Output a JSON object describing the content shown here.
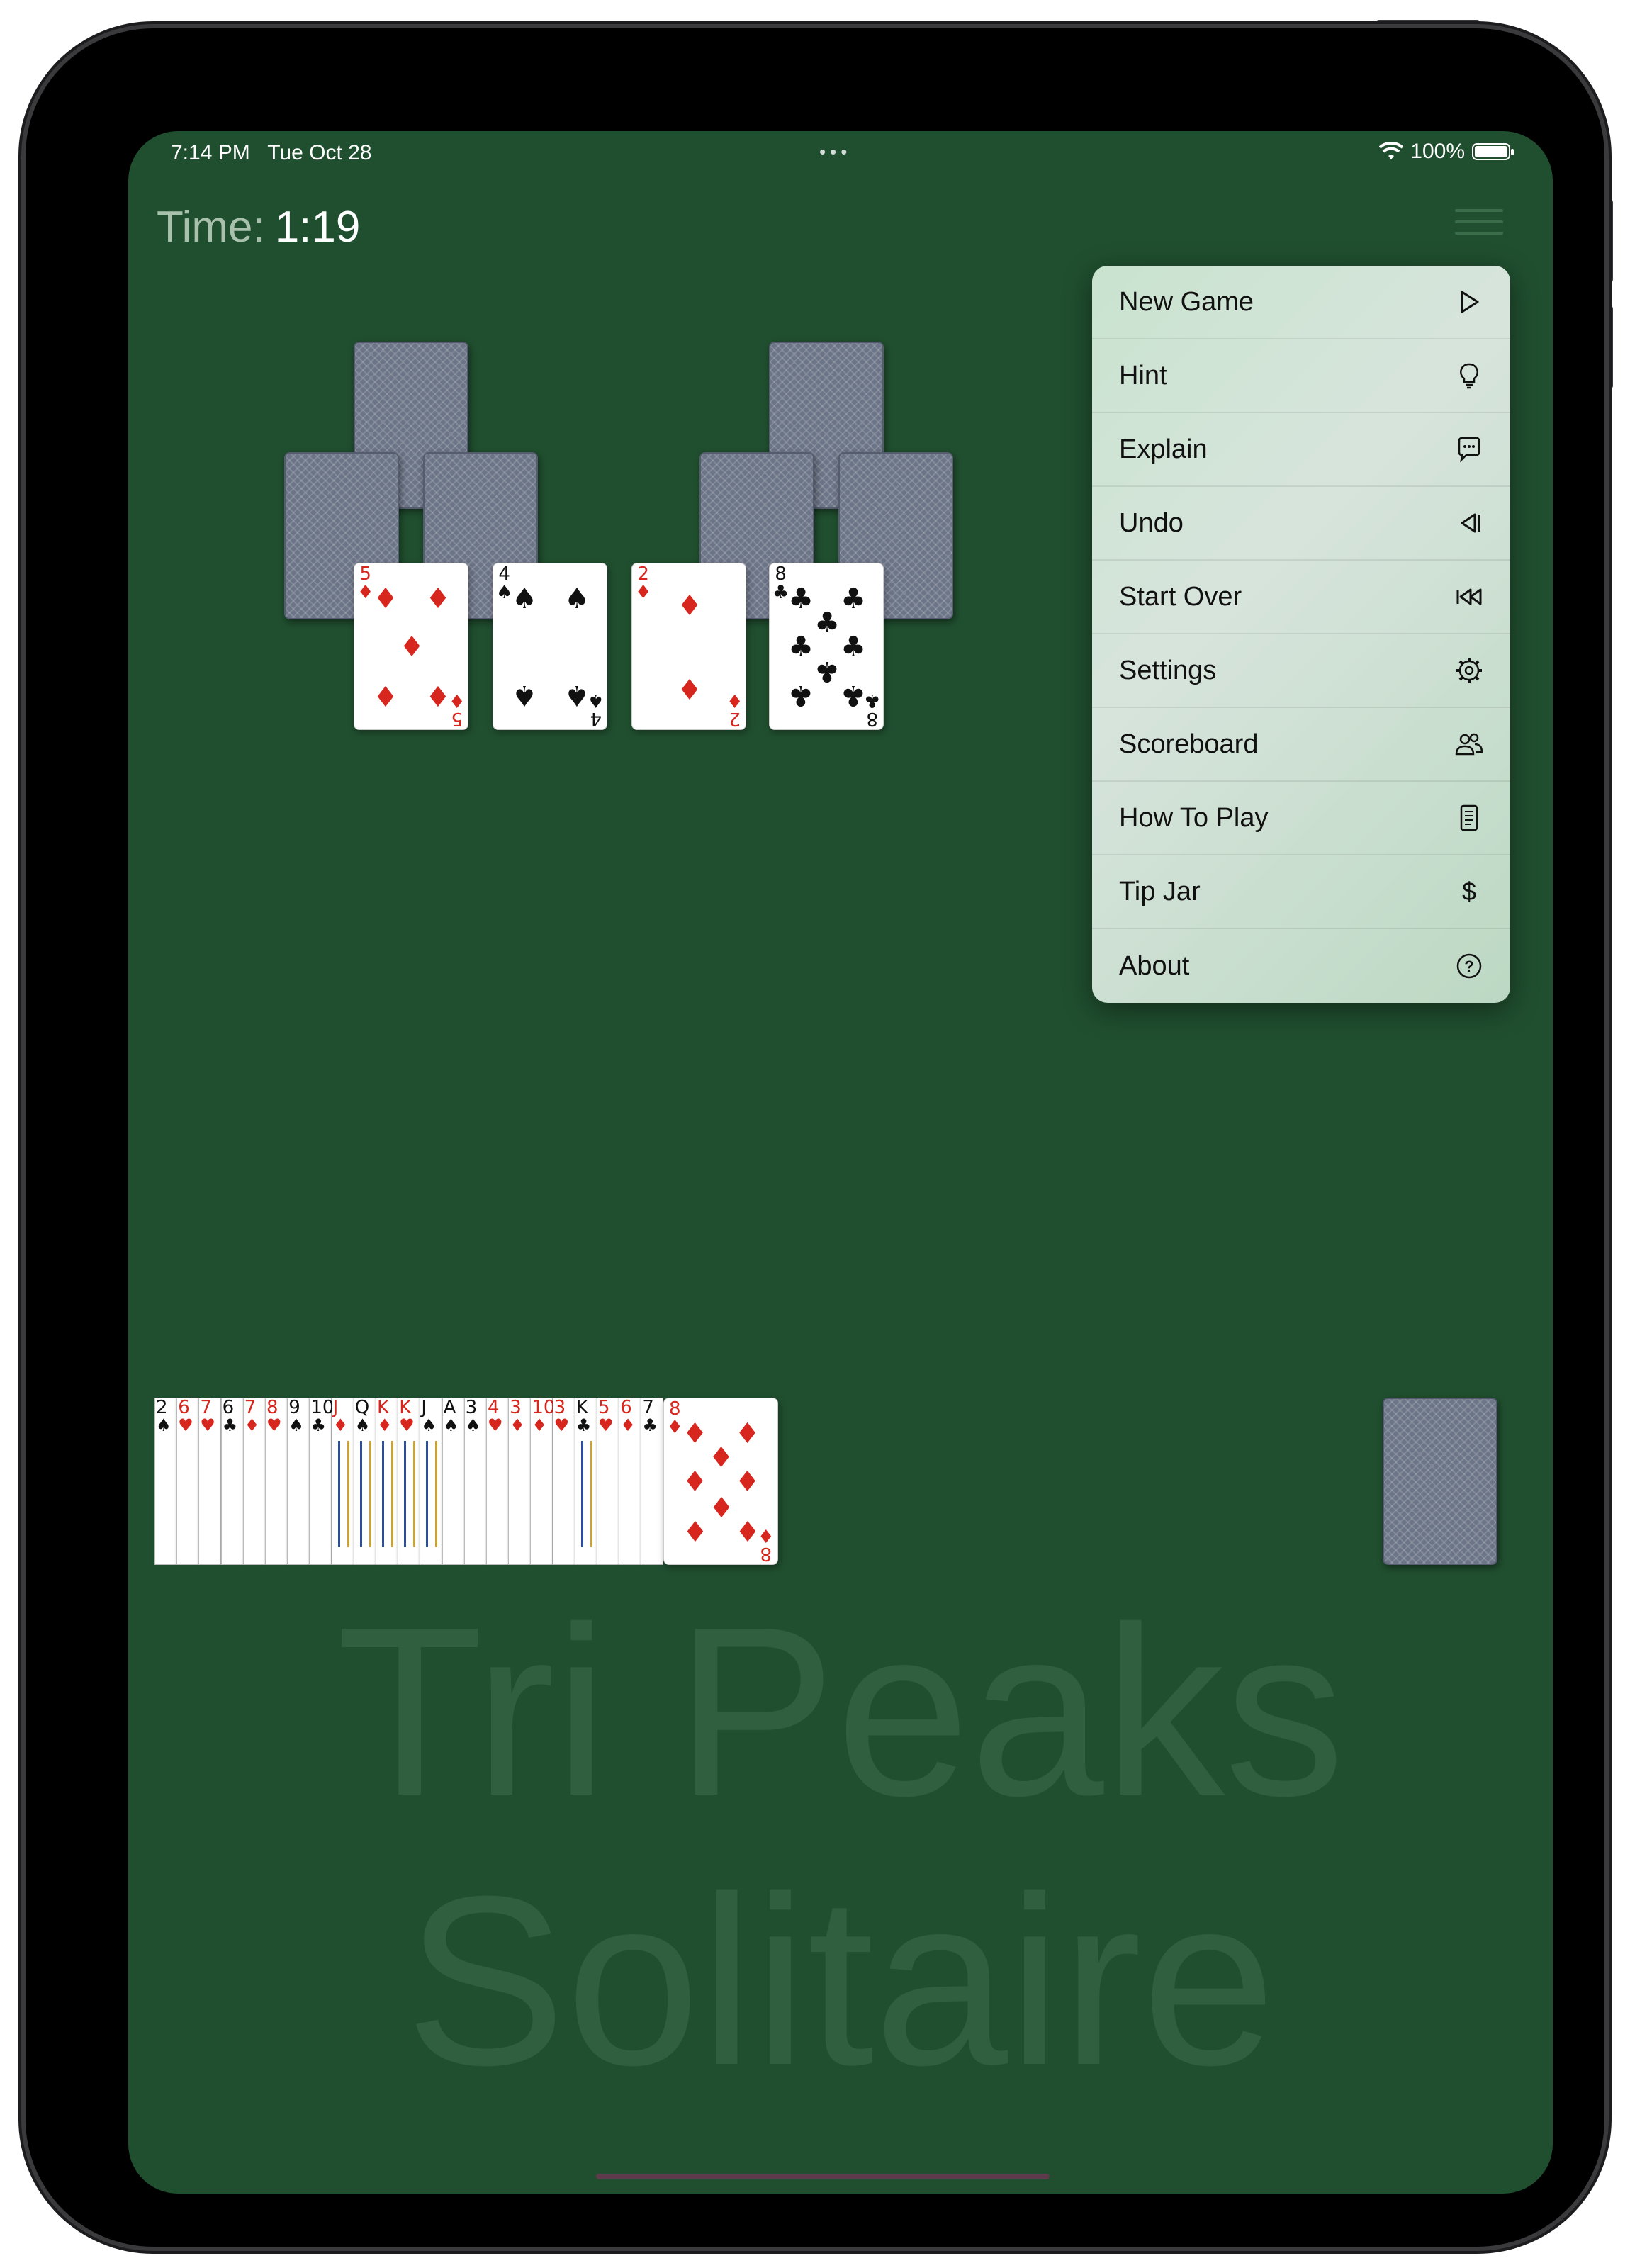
{
  "status_bar": {
    "time": "7:14 PM",
    "date": "Tue Oct 28",
    "dots": "•••",
    "battery": "100%"
  },
  "timer": {
    "label": "Time:",
    "value": "1:19"
  },
  "watermark": {
    "line1": "Tri Peaks",
    "line2": "Solitaire"
  },
  "peaks": [
    {
      "rank": "5",
      "suit": "♦",
      "color": "red"
    },
    {
      "rank": "4",
      "suit": "♠",
      "color": "black"
    },
    {
      "rank": "2",
      "suit": "♦",
      "color": "red"
    },
    {
      "rank": "8",
      "suit": "♣",
      "color": "black"
    }
  ],
  "waste_pile": [
    {
      "rank": "2",
      "suit": "♠",
      "color": "black"
    },
    {
      "rank": "6",
      "suit": "♥",
      "color": "red"
    },
    {
      "rank": "7",
      "suit": "♥",
      "color": "red"
    },
    {
      "rank": "6",
      "suit": "♣",
      "color": "black"
    },
    {
      "rank": "7",
      "suit": "♦",
      "color": "red"
    },
    {
      "rank": "8",
      "suit": "♥",
      "color": "red"
    },
    {
      "rank": "9",
      "suit": "♠",
      "color": "black"
    },
    {
      "rank": "10",
      "suit": "♣",
      "color": "black"
    },
    {
      "rank": "J",
      "suit": "♦",
      "color": "red"
    },
    {
      "rank": "Q",
      "suit": "♠",
      "color": "black"
    },
    {
      "rank": "K",
      "suit": "♦",
      "color": "red"
    },
    {
      "rank": "K",
      "suit": "♥",
      "color": "red"
    },
    {
      "rank": "J",
      "suit": "♠",
      "color": "black"
    },
    {
      "rank": "A",
      "suit": "♠",
      "color": "black"
    },
    {
      "rank": "3",
      "suit": "♠",
      "color": "black"
    },
    {
      "rank": "4",
      "suit": "♥",
      "color": "red"
    },
    {
      "rank": "3",
      "suit": "♦",
      "color": "red"
    },
    {
      "rank": "10",
      "suit": "♦",
      "color": "red"
    },
    {
      "rank": "3",
      "suit": "♥",
      "color": "red"
    },
    {
      "rank": "K",
      "suit": "♣",
      "color": "black"
    },
    {
      "rank": "5",
      "suit": "♥",
      "color": "red"
    },
    {
      "rank": "6",
      "suit": "♦",
      "color": "red"
    },
    {
      "rank": "7",
      "suit": "♣",
      "color": "black"
    }
  ],
  "waste_top": {
    "rank": "8",
    "suit": "♦",
    "color": "red"
  },
  "menu": [
    {
      "label": "New Game",
      "icon": "play-icon"
    },
    {
      "label": "Hint",
      "icon": "lightbulb-icon"
    },
    {
      "label": "Explain",
      "icon": "speech-bubble-icon"
    },
    {
      "label": "Undo",
      "icon": "undo-icon"
    },
    {
      "label": "Start Over",
      "icon": "rewind-icon"
    },
    {
      "label": "Settings",
      "icon": "gear-icon"
    },
    {
      "label": "Scoreboard",
      "icon": "people-icon"
    },
    {
      "label": "How To Play",
      "icon": "document-icon"
    },
    {
      "label": "Tip Jar",
      "icon": "dollar-icon"
    },
    {
      "label": "About",
      "icon": "question-circle-icon"
    }
  ],
  "colors": {
    "felt": "#204f2f",
    "card_red": "#d7261e",
    "card_back": "#6c7487"
  }
}
